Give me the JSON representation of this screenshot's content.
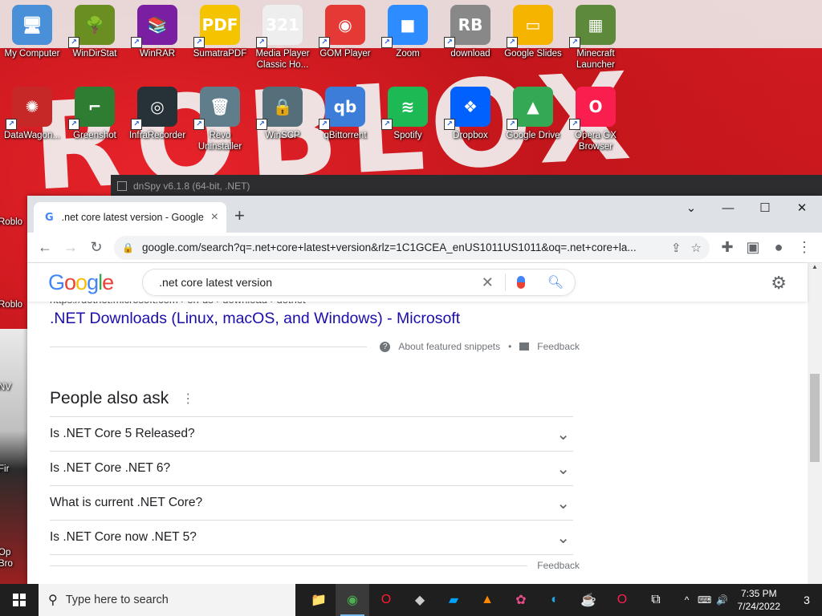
{
  "desktop": {
    "background_text": "ROBLOX",
    "icons": [
      {
        "label": "My Computer",
        "glyph": "🖥",
        "color": "#4a90d9"
      },
      {
        "label": "WinDirStat",
        "glyph": "🌳",
        "color": "#6b8e23"
      },
      {
        "label": "WinRAR",
        "glyph": "📚",
        "color": "#7b1fa2"
      },
      {
        "label": "SumatraPDF",
        "glyph": "PDF",
        "color": "#f5c400"
      },
      {
        "label": "Media Player Classic Ho...",
        "glyph": "321",
        "color": "#eeeeee"
      },
      {
        "label": "GOM Player",
        "glyph": "◉",
        "color": "#e53935"
      },
      {
        "label": "Zoom",
        "glyph": "■",
        "color": "#2d8cff"
      },
      {
        "label": "download",
        "glyph": "RB",
        "color": "#888888"
      },
      {
        "label": "Google Slides",
        "glyph": "▭",
        "color": "#f4b400"
      },
      {
        "label": "Minecraft Launcher",
        "glyph": "▦",
        "color": "#5d8a3a"
      },
      {
        "label": "DataWagon...",
        "glyph": "✺",
        "color": "#c62828"
      },
      {
        "label": "Greenshot",
        "glyph": "⌐",
        "color": "#2e7d32"
      },
      {
        "label": "InfraRecorder",
        "glyph": "◎",
        "color": "#263238"
      },
      {
        "label": "Revo Uninstaller",
        "glyph": "🗑",
        "color": "#607d8b"
      },
      {
        "label": "WinSCP",
        "glyph": "🔒",
        "color": "#546e7a"
      },
      {
        "label": "qBittorrent",
        "glyph": "qb",
        "color": "#3b7dd8"
      },
      {
        "label": "Spotify",
        "glyph": "≋",
        "color": "#1db954"
      },
      {
        "label": "Dropbox",
        "glyph": "❖",
        "color": "#0061ff"
      },
      {
        "label": "Google Drive",
        "glyph": "▲",
        "color": "#34a853"
      },
      {
        "label": "Opera GX Browser",
        "glyph": "O",
        "color": "#fa1e4e"
      }
    ],
    "left_partial_labels": [
      "Roblo",
      "Roblo",
      "NV",
      "Fir",
      "Op",
      "Bro"
    ]
  },
  "dnspy_title": "dnSpy v6.1.8 (64-bit, .NET)",
  "browser": {
    "tab_title": ".net core latest version - Google",
    "tab_favicon": "G",
    "new_tab": "+",
    "window_controls": {
      "dropdown": "⌄",
      "minimize": "—",
      "maximize": "☐",
      "close": "✕"
    },
    "nav": {
      "back": "←",
      "forward": "→",
      "reload": "↻"
    },
    "url": "google.com/search?q=.net+core+latest+version&rlz=1C1GCEA_enUS1011US1011&oq=.net+core+la...",
    "toolbar_actions": [
      "share-icon",
      "star-icon",
      "extensions-icon",
      "sidepanel-icon",
      "profile-icon",
      "menu-icon"
    ]
  },
  "google": {
    "logo": [
      "G",
      "o",
      "o",
      "g",
      "l",
      "e"
    ],
    "query": ".net core latest version",
    "clear": "✕",
    "result": {
      "breadcrumb": "https://dotnet.microsoft.com › en-us › download › dotnet",
      "title": ".NET Downloads (Linux, macOS, and Windows) - Microsoft"
    },
    "snippet_bar": {
      "about": "About featured snippets",
      "dot": "•",
      "feedback": "Feedback"
    },
    "people_also_ask": {
      "heading": "People also ask",
      "questions": [
        "Is .NET Core 5 Released?",
        "Is .NET Core .NET 6?",
        "What is current .NET Core?",
        "Is .NET Core now .NET 5?"
      ],
      "feedback": "Feedback"
    }
  },
  "taskbar": {
    "search_placeholder": "Type here to search",
    "apps": [
      {
        "name": "file-explorer-icon",
        "glyph": "📁",
        "color": "#f6c343",
        "active": false
      },
      {
        "name": "chrome-icon",
        "glyph": "◉",
        "color": "#4caf50",
        "active": true
      },
      {
        "name": "opera-icon",
        "glyph": "O",
        "color": "#ff1b2d",
        "active": false
      },
      {
        "name": "roblox-icon",
        "glyph": "◆",
        "color": "#cccccc",
        "active": false
      },
      {
        "name": "roblox-studio-icon",
        "glyph": "▰",
        "color": "#00a2ff",
        "active": false
      },
      {
        "name": "vlc-icon",
        "glyph": "▲",
        "color": "#ff8800",
        "active": false
      },
      {
        "name": "paint-icon",
        "glyph": "✿",
        "color": "#e94c89",
        "active": false
      },
      {
        "name": "edge-icon",
        "glyph": "◐",
        "color": "#1fa5e3",
        "active": false
      },
      {
        "name": "java-icon",
        "glyph": "☕",
        "color": "#e76f00",
        "active": false
      },
      {
        "name": "opera-gx-icon",
        "glyph": "O",
        "color": "#fa1e4e",
        "active": false
      },
      {
        "name": "task-view-icon",
        "glyph": "⧉",
        "color": "#ffffff",
        "active": false
      }
    ],
    "tray": {
      "chevron": "^",
      "network": "⌨",
      "volume": "🔊",
      "time": "7:35 PM",
      "date": "7/24/2022",
      "notifications": "3"
    }
  }
}
